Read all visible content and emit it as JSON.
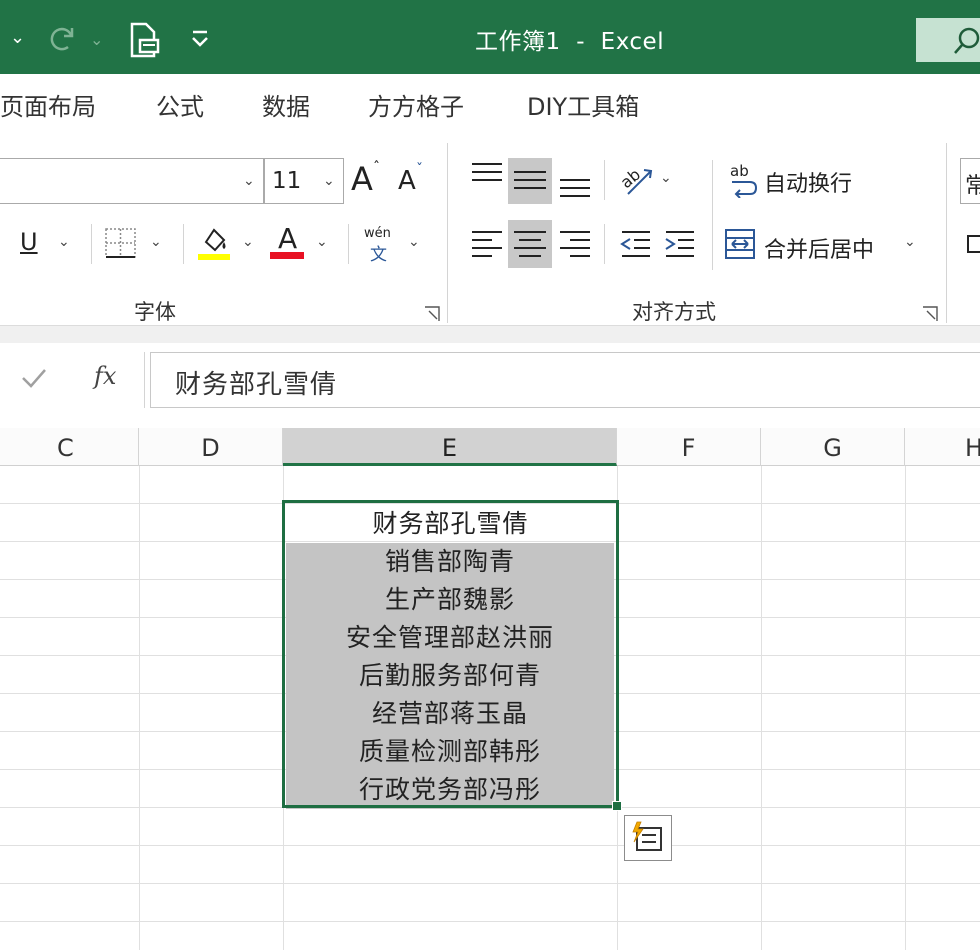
{
  "titlebar": {
    "title": "工作簿1  -  Excel"
  },
  "tabs": [
    {
      "label": "页面布局"
    },
    {
      "label": "公式"
    },
    {
      "label": "数据"
    },
    {
      "label": "方方格子"
    },
    {
      "label": "DIY工具箱"
    }
  ],
  "ribbon": {
    "font": {
      "name": "",
      "size": "11",
      "group_label": "字体",
      "increase_label": "A",
      "decrease_label": "A",
      "underline_label": "U",
      "font_color_label": "A",
      "font_color": "#e81123",
      "fill_color": "#ffff00",
      "phonetic_top": "wén",
      "phonetic_bottom": "文"
    },
    "alignment": {
      "group_label": "对齐方式",
      "wrap_text_label": "自动换行",
      "merge_center_label": "合并后居中",
      "wrap_icon_text": "ab"
    },
    "number_partial": "常"
  },
  "formula_bar": {
    "fx_label": "fx",
    "value": "财务部孔雪倩"
  },
  "sheet": {
    "columns": [
      "C",
      "D",
      "E",
      "F",
      "G",
      "H"
    ],
    "active_column": "E",
    "cells": [
      "财务部孔雪倩",
      "销售部陶青",
      "生产部魏影",
      "安全管理部赵洪丽",
      "后勤服务部何青",
      "经营部蒋玉晶",
      "质量检测部韩彤",
      "行政党务部冯彤"
    ]
  },
  "colors": {
    "excel_green": "#217346",
    "selection_border": "#1e6e42",
    "shaded_cell": "#c4c4c4"
  }
}
